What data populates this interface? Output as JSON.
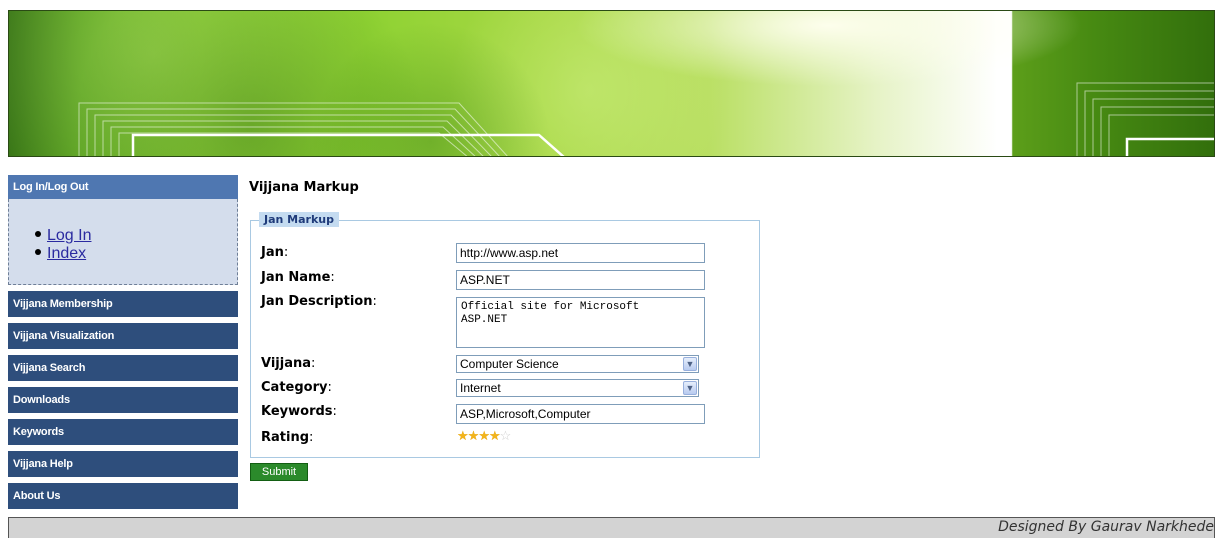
{
  "sidebar": {
    "login_header": "Log In/Log Out",
    "login_links": [
      "Log In",
      "Index"
    ],
    "nav_items": [
      "Vijjana Membership",
      "Vijjana Visualization",
      "Vijjana Search",
      "Downloads",
      "Keywords",
      "Vijjana Help",
      "About Us"
    ]
  },
  "main": {
    "page_title": "Vijjana Markup",
    "fieldset_legend": "Jan Markup",
    "fields": {
      "jan": {
        "label": "Jan",
        "value": "http://www.asp.net"
      },
      "jan_name": {
        "label": "Jan Name",
        "value": "ASP.NET"
      },
      "jan_description": {
        "label": "Jan Description",
        "value": "Official site for Microsoft\nASP.NET"
      },
      "vijjana": {
        "label": "Vijjana",
        "value": "Computer Science"
      },
      "category": {
        "label": "Category",
        "value": "Internet"
      },
      "keywords": {
        "label": "Keywords",
        "value": "ASP,Microsoft,Computer"
      },
      "rating": {
        "label": "Rating",
        "stars_filled": 4,
        "stars_total": 5
      }
    },
    "submit_label": "Submit"
  },
  "footer": {
    "credit": "Designed By Gaurav Narkhede"
  },
  "colors": {
    "nav_bg": "#2e4e7c",
    "login_header_bg": "#4f77b1",
    "login_box_bg": "#d4ddec",
    "submit_bg": "#2b8a2b",
    "footer_bg": "#d3d3d3"
  },
  "icons": {
    "select_arrow": "chevron-down-icon",
    "rating_star": "star-icon"
  }
}
